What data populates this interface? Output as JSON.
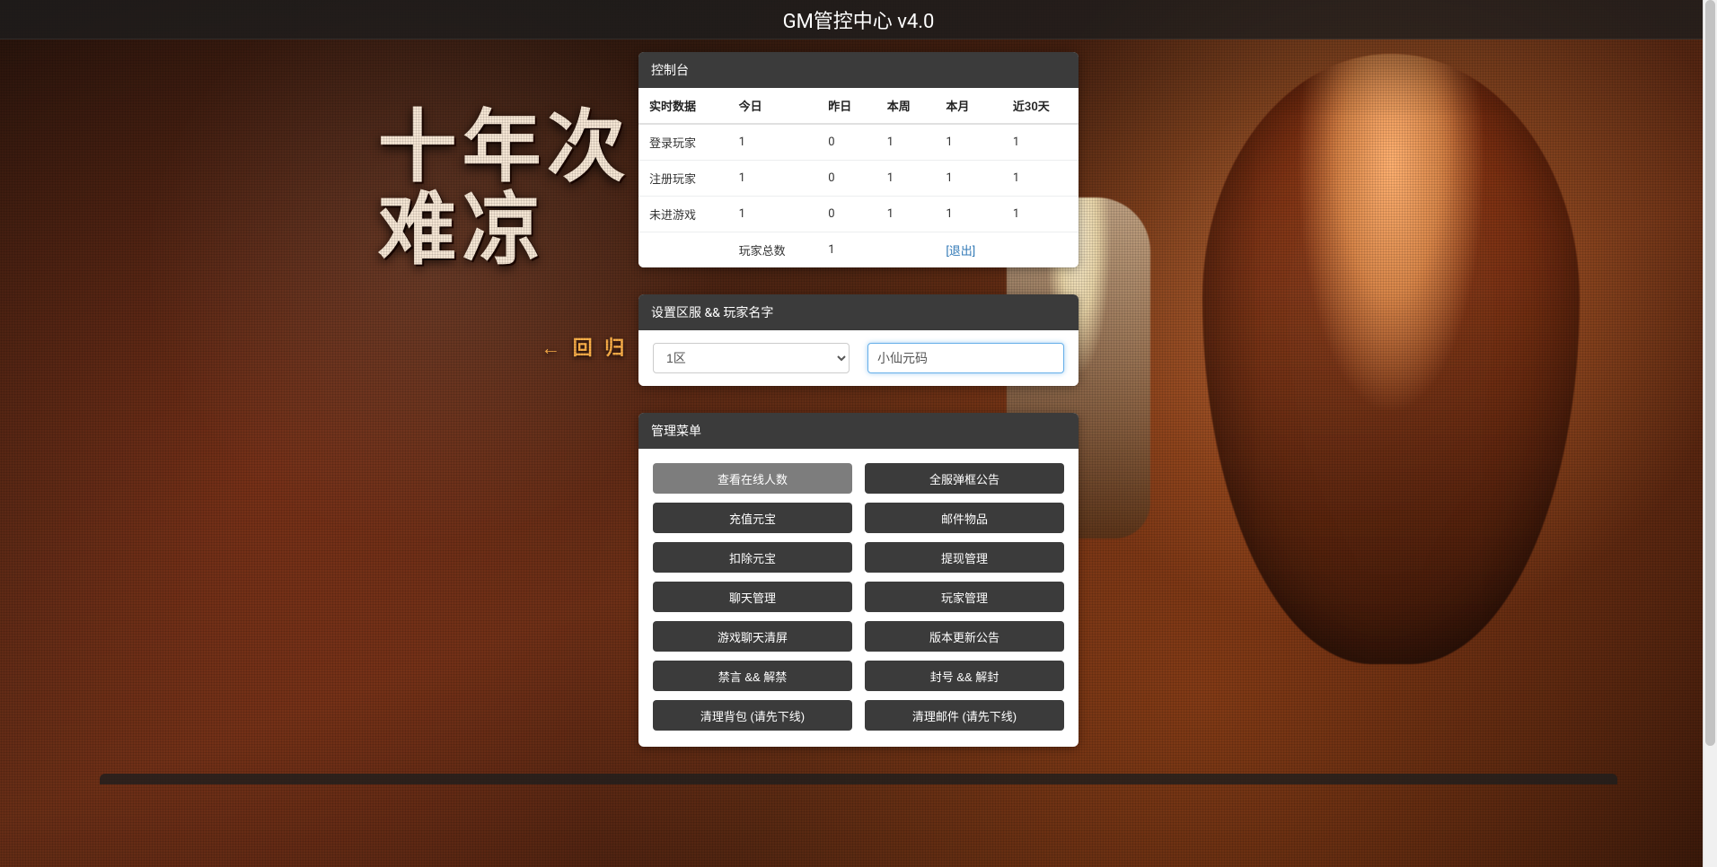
{
  "header": {
    "title": "GM管控中心 v4.0"
  },
  "bg": {
    "calli_line1": "十年次",
    "calli_line2": "难凉",
    "back": "←  回 归"
  },
  "console": {
    "title": "控制台",
    "columns": [
      "实时数据",
      "今日",
      "昨日",
      "本周",
      "本月",
      "近30天"
    ],
    "rows": [
      {
        "label": "登录玩家",
        "today": "1",
        "yesterday": "0",
        "week": "1",
        "month": "1",
        "last30": "1"
      },
      {
        "label": "注册玩家",
        "today": "1",
        "yesterday": "0",
        "week": "1",
        "month": "1",
        "last30": "1"
      },
      {
        "label": "未进游戏",
        "today": "1",
        "yesterday": "0",
        "week": "1",
        "month": "1",
        "last30": "1"
      }
    ],
    "footer": {
      "total_players_label": "玩家总数",
      "total_players_value": "1",
      "logout": "[退出]"
    }
  },
  "server_panel": {
    "title": "设置区服 && 玩家名字",
    "server_selected": "1区",
    "player_value": "小仙元码"
  },
  "menu": {
    "title": "管理菜单",
    "items": [
      {
        "label": "查看在线人数",
        "active": true
      },
      {
        "label": "全服弹框公告"
      },
      {
        "label": "充值元宝"
      },
      {
        "label": "邮件物品"
      },
      {
        "label": "扣除元宝"
      },
      {
        "label": "提现管理"
      },
      {
        "label": "聊天管理"
      },
      {
        "label": "玩家管理"
      },
      {
        "label": "游戏聊天清屏"
      },
      {
        "label": "版本更新公告"
      },
      {
        "label": "禁言 && 解禁"
      },
      {
        "label": "封号 && 解封"
      },
      {
        "label": "清理背包 (请先下线)"
      },
      {
        "label": "清理邮件 (请先下线)"
      }
    ]
  }
}
